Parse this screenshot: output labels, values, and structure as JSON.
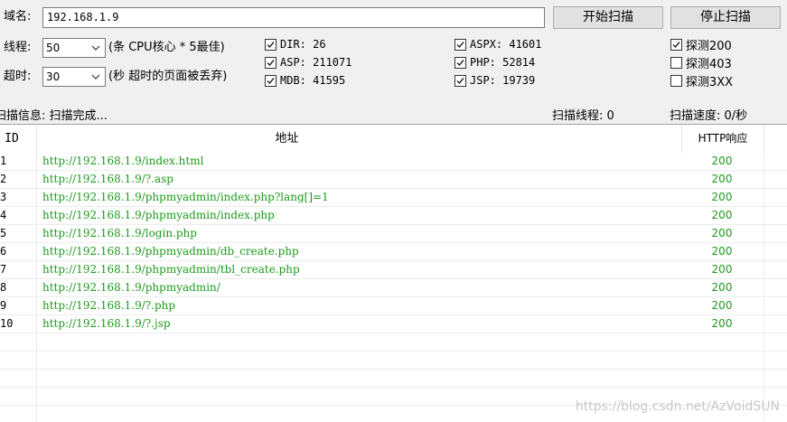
{
  "domain_row": {
    "label": "域名:",
    "value": "192.168.1.9"
  },
  "buttons": {
    "start": "开始扫描",
    "stop": "停止扫描"
  },
  "threads_row": {
    "label": "线程:",
    "value": "50",
    "hint": "(条 CPU核心 * 5最佳)"
  },
  "timeout_row": {
    "label": "超时:",
    "value": "30",
    "hint": "(秒 超时的页面被丢弃)"
  },
  "dict_checks": [
    {
      "label": "DIR: 26",
      "checked": true
    },
    {
      "label": "ASP: 211071",
      "checked": true
    },
    {
      "label": "MDB: 41595",
      "checked": true
    },
    {
      "label": "ASPX: 41601",
      "checked": true
    },
    {
      "label": "PHP: 52814",
      "checked": true
    },
    {
      "label": "JSP: 19739",
      "checked": true
    }
  ],
  "probe_checks": [
    {
      "label": "探测200",
      "checked": true
    },
    {
      "label": "探测403",
      "checked": false
    },
    {
      "label": "探测3XX",
      "checked": false
    }
  ],
  "status": {
    "info": "扫描信息: 扫描完成...",
    "threads": "扫描线程: 0",
    "speed": "扫描速度: 0/秒"
  },
  "table": {
    "columns": [
      "ID",
      "地址",
      "HTTP响应"
    ],
    "rows": [
      {
        "id": "1",
        "url": "http://192.168.1.9/index.html",
        "code": "200"
      },
      {
        "id": "2",
        "url": "http://192.168.1.9/?.asp",
        "code": "200"
      },
      {
        "id": "3",
        "url": "http://192.168.1.9/phpmyadmin/index.php?lang[]=1",
        "code": "200"
      },
      {
        "id": "4",
        "url": "http://192.168.1.9/phpmyadmin/index.php",
        "code": "200"
      },
      {
        "id": "5",
        "url": "http://192.168.1.9/login.php",
        "code": "200"
      },
      {
        "id": "6",
        "url": "http://192.168.1.9/phpmyadmin/db_create.php",
        "code": "200"
      },
      {
        "id": "7",
        "url": "http://192.168.1.9/phpmyadmin/tbl_create.php",
        "code": "200"
      },
      {
        "id": "8",
        "url": "http://192.168.1.9/phpmyadmin/",
        "code": "200"
      },
      {
        "id": "9",
        "url": "http://192.168.1.9/?.php",
        "code": "200"
      },
      {
        "id": "10",
        "url": "http://192.168.1.9/?.jsp",
        "code": "200"
      }
    ]
  },
  "watermark": "https://blog.csdn.net/AzVoidSUN",
  "colors": {
    "url_green": "#1c9a1c",
    "window_bg": "#f0f0f0"
  }
}
